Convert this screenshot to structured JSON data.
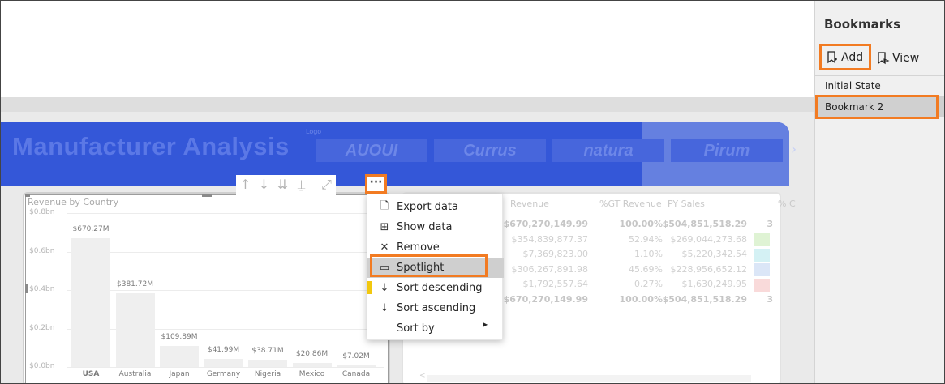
{
  "report": {
    "title": "Manufacturer Analysis",
    "logo_label": "Logo",
    "logos": [
      "AUOUI",
      "Currus",
      "natura",
      "Pirum"
    ],
    "next_arrow": "›"
  },
  "visual_toolbar": {
    "drill_up": "↑",
    "drill_down": "↓",
    "expand_all": "⇊",
    "drill_hierarchy": "⍊",
    "focus_mode": "⤢",
    "more_options": "···"
  },
  "chart_data": {
    "type": "bar",
    "title": "Revenue by Country",
    "categories": [
      "USA",
      "Australia",
      "Japan",
      "Germany",
      "Nigeria",
      "Mexico",
      "Canada"
    ],
    "values": [
      670.27,
      381.72,
      109.89,
      41.99,
      38.71,
      20.86,
      7.02
    ],
    "data_labels": [
      "$670.27M",
      "$381.72M",
      "$109.89M",
      "$41.99M",
      "$38.71M",
      "$20.86M",
      "$7.02M"
    ],
    "y_ticks": [
      "$0.8bn",
      "$0.6bn",
      "$0.4bn",
      "$0.2bn",
      "$0.0bn"
    ],
    "ylim": [
      0,
      800
    ],
    "grid": true
  },
  "table": {
    "headers": [
      "Revenue",
      "%GT Revenue",
      "PY Sales",
      "% C"
    ],
    "rows": [
      [
        "$670,270,149.99",
        "100.00%",
        "$504,851,518.29",
        "3"
      ],
      [
        "$354,839,877.37",
        "52.94%",
        "$269,044,273.68",
        ""
      ],
      [
        "$7,369,823.00",
        "1.10%",
        "$5,220,342.54",
        ""
      ],
      [
        "$306,267,891.98",
        "45.69%",
        "$228,956,652.12",
        ""
      ],
      [
        "$1,792,557.64",
        "0.27%",
        "$1,630,249.95",
        ""
      ],
      [
        "$670,270,149.99",
        "100.00%",
        "$504,851,518.29",
        "3"
      ]
    ],
    "cf_colors": [
      "#dff3d4",
      "#d4f1f4",
      "#dbe6f7",
      "#f9dada"
    ],
    "scroll_left": "<"
  },
  "context_menu": {
    "items": [
      {
        "label": "Export data",
        "icon": "🗋"
      },
      {
        "label": "Show data",
        "icon": "⊞"
      },
      {
        "label": "Remove",
        "icon": "✕"
      },
      {
        "label": "Spotlight",
        "icon": "▭"
      },
      {
        "label": "Sort descending",
        "icon": "↓"
      },
      {
        "label": "Sort ascending",
        "icon": "↓"
      },
      {
        "label": "Sort by",
        "icon": ""
      }
    ],
    "submenu_arrow": "▶"
  },
  "bookmarks": {
    "title": "Bookmarks",
    "add_label": "Add",
    "view_label": "View",
    "items": [
      "Initial State",
      "Bookmark 2"
    ],
    "accent": "#f27b22"
  }
}
